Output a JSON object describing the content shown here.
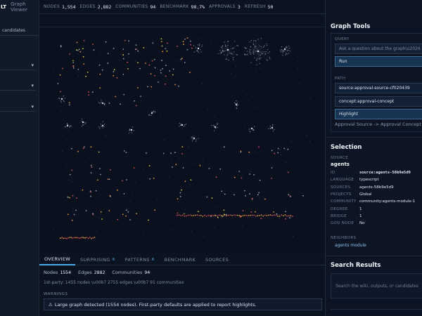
{
  "left": {
    "tab_active": "LT",
    "tab_other": "Graph Viewer",
    "field_value": "candidates"
  },
  "stats": [
    {
      "k": "NODES",
      "v": "1,554"
    },
    {
      "k": "EDGES",
      "v": "2,882"
    },
    {
      "k": "COMMUNITIES",
      "v": "94"
    },
    {
      "k": "BENCHMARK",
      "v": "98.7%"
    },
    {
      "k": "APPROVALS",
      "v": "3"
    },
    {
      "k": "REFRESH",
      "v": "50"
    }
  ],
  "tabs": [
    {
      "label": "OVERVIEW",
      "badge": ""
    },
    {
      "label": "SURPRISING",
      "badge": "6"
    },
    {
      "label": "PATTERNS",
      "badge": "6"
    },
    {
      "label": "BENCHMARK",
      "badge": ""
    },
    {
      "label": "SOURCES",
      "badge": ""
    }
  ],
  "summary": {
    "nodes_label": "Nodes",
    "nodes": "1554",
    "edges_label": "Edges",
    "edges": "2882",
    "communities_label": "Communities",
    "communities": "94"
  },
  "subline": "1st-party: 1455 nodes \\u00b7 2755 edges \\u00b7 91 communities",
  "warnings": {
    "heading": "WARNINGS",
    "icon": "warning-icon",
    "glyph": "⚠",
    "text": "Large graph detected (1554 nodes). First-party defaults are applied to report highlights."
  },
  "graph_tools": {
    "title": "Graph Tools",
    "query_label": "QUERY",
    "query_placeholder": "Ask a question about the graph\\u2026",
    "run_label": "Run",
    "path_label": "PATH",
    "path_from": "source:approval-source-cf020439",
    "path_to": "concept:approval-concept",
    "highlight_label": "Highlight",
    "path_result": "Approval Source -> Approval Concept"
  },
  "selection": {
    "title": "Selection",
    "kind": "SOURCE",
    "name": "agents",
    "rows": [
      {
        "k": "ID",
        "v": "source:agents-58b9e5d9",
        "mono": true
      },
      {
        "k": "LANGUAGE",
        "v": "typescript"
      },
      {
        "k": "SOURCES",
        "v": "agents-58b9e5d9"
      },
      {
        "k": "PROJECTS",
        "v": "Global"
      },
      {
        "k": "COMMUNITY",
        "v": "community:agents-module-1"
      },
      {
        "k": "DEGREE",
        "v": "1"
      },
      {
        "k": "BRIDGE",
        "v": "1"
      },
      {
        "k": "GOD NODE",
        "v": "No"
      }
    ],
    "neighbors_label": "NEIGHBORS",
    "neighbor": "agents module"
  },
  "search_results": {
    "title": "Search Results",
    "placeholder": "Search the wiki, outputs, or candidates"
  },
  "colors": {
    "accent": "#4aa8e8",
    "node_red": "#e2545f",
    "node_orange": "#e8a23a",
    "node_yellow": "#e6d24a",
    "node_gray": "#9aa6b8"
  }
}
